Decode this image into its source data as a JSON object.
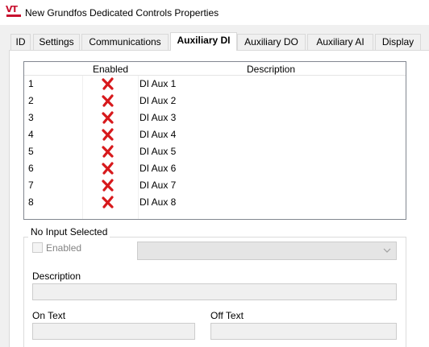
{
  "window": {
    "title": "New Grundfos Dedicated Controls Properties",
    "logo": {
      "text": "VT",
      "icon": "vt-logo-icon"
    }
  },
  "tabs": [
    {
      "label": "ID"
    },
    {
      "label": "Settings"
    },
    {
      "label": "Communications"
    },
    {
      "label": "Auxiliary DI",
      "active": true
    },
    {
      "label": "Auxiliary DO"
    },
    {
      "label": "Auxiliary AI"
    },
    {
      "label": "Display"
    }
  ],
  "grid": {
    "columns": {
      "number": "",
      "enabled": "Enabled",
      "description": "Description"
    },
    "rows": [
      {
        "number": "1",
        "enabled": false,
        "icon": "red-x-icon",
        "description": "DI Aux 1"
      },
      {
        "number": "2",
        "enabled": false,
        "icon": "red-x-icon",
        "description": "DI Aux 2"
      },
      {
        "number": "3",
        "enabled": false,
        "icon": "red-x-icon",
        "description": "DI Aux 3"
      },
      {
        "number": "4",
        "enabled": false,
        "icon": "red-x-icon",
        "description": "DI Aux 4"
      },
      {
        "number": "5",
        "enabled": false,
        "icon": "red-x-icon",
        "description": "DI Aux 5"
      },
      {
        "number": "6",
        "enabled": false,
        "icon": "red-x-icon",
        "description": "DI Aux 6"
      },
      {
        "number": "7",
        "enabled": false,
        "icon": "red-x-icon",
        "description": "DI Aux 7"
      },
      {
        "number": "8",
        "enabled": false,
        "icon": "red-x-icon",
        "description": "DI Aux 8"
      }
    ]
  },
  "detail": {
    "group_title": "No Input Selected",
    "enabled_label": "Enabled",
    "enabled_checked": false,
    "combo_value": "",
    "description_label": "Description",
    "description_value": "",
    "on_text_label": "On Text",
    "on_text_value": "",
    "off_text_label": "Off Text",
    "off_text_value": ""
  },
  "colors": {
    "x_icon": "#d7191c",
    "accent_logo": "#c8102e",
    "window_bg": "#f0f0f0"
  }
}
